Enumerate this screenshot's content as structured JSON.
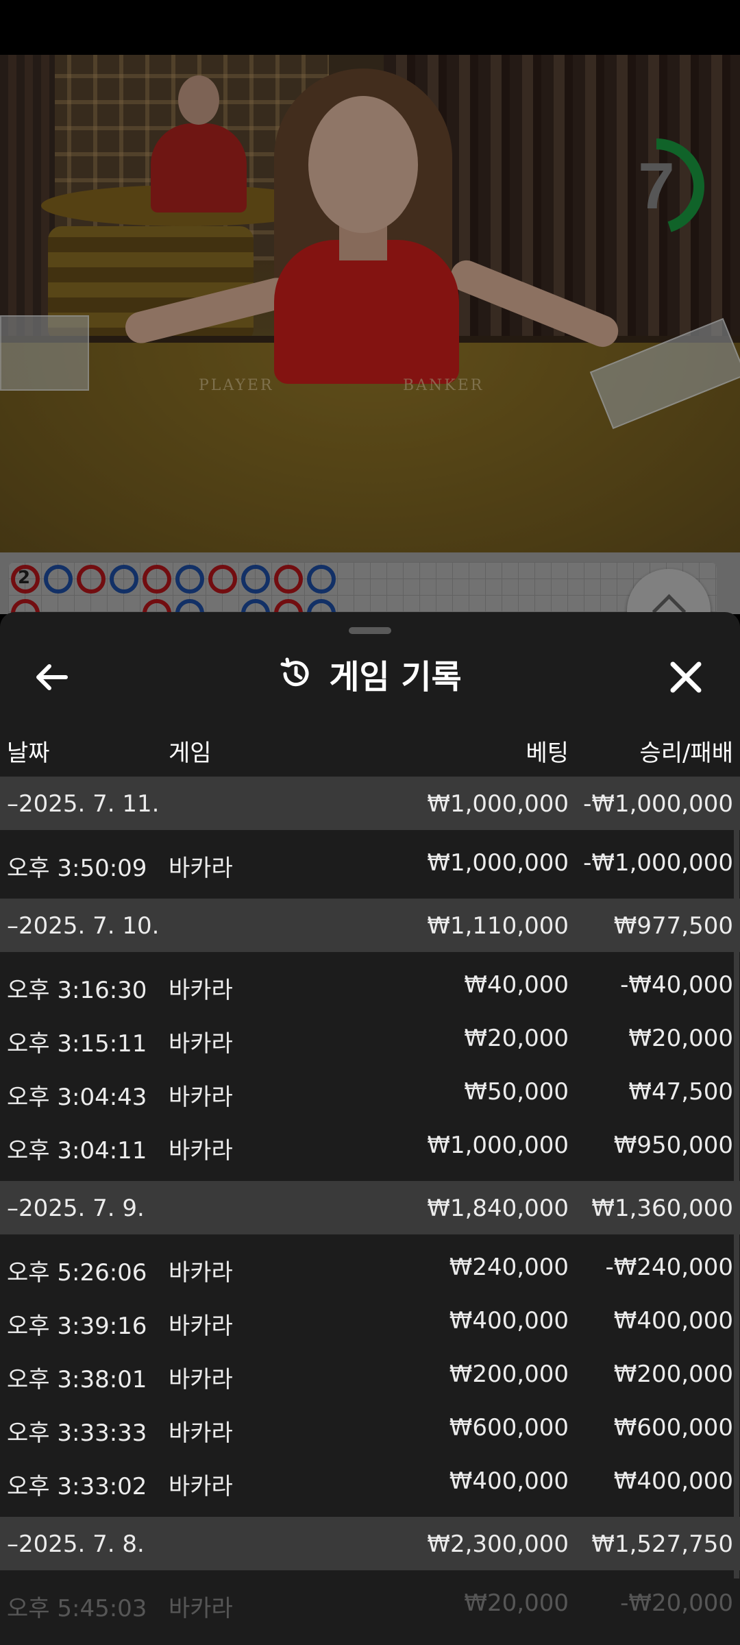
{
  "video": {
    "countdown": "7",
    "countdown_fraction": 0.45,
    "table_labels": {
      "player": "PLAYER",
      "banker": "BANKER"
    }
  },
  "roadmap": {
    "count": "2",
    "row1": [
      "red",
      "blue",
      "red",
      "blue",
      "red",
      "blue",
      "red",
      "blue",
      "red",
      "blue"
    ],
    "row2": [
      "red",
      "",
      "",
      "",
      "red",
      "blue",
      "",
      "blue",
      "red",
      "blue"
    ]
  },
  "sheet": {
    "title": "게임 기록",
    "icons": {
      "back": "arrow-left-icon",
      "history": "history-icon",
      "close": "close-icon"
    },
    "columns": {
      "date": "날짜",
      "game": "게임",
      "bet": "베팅",
      "win_loss": "승리/패배"
    },
    "days": [
      {
        "date": "–2025. 7. 11.",
        "bet": "₩1,000,000",
        "result": "-₩1,000,000",
        "rows": [
          {
            "time": "오후 3:50:09",
            "game": "바카라",
            "bet": "₩1,000,000",
            "result": "-₩1,000,000"
          }
        ]
      },
      {
        "date": "–2025. 7. 10.",
        "bet": "₩1,110,000",
        "result": "₩977,500",
        "rows": [
          {
            "time": "오후 3:16:30",
            "game": "바카라",
            "bet": "₩40,000",
            "result": "-₩40,000"
          },
          {
            "time": "오후 3:15:11",
            "game": "바카라",
            "bet": "₩20,000",
            "result": "₩20,000"
          },
          {
            "time": "오후 3:04:43",
            "game": "바카라",
            "bet": "₩50,000",
            "result": "₩47,500"
          },
          {
            "time": "오후 3:04:11",
            "game": "바카라",
            "bet": "₩1,000,000",
            "result": "₩950,000"
          }
        ]
      },
      {
        "date": "–2025. 7. 9.",
        "bet": "₩1,840,000",
        "result": "₩1,360,000",
        "rows": [
          {
            "time": "오후 5:26:06",
            "game": "바카라",
            "bet": "₩240,000",
            "result": "-₩240,000"
          },
          {
            "time": "오후 3:39:16",
            "game": "바카라",
            "bet": "₩400,000",
            "result": "₩400,000"
          },
          {
            "time": "오후 3:38:01",
            "game": "바카라",
            "bet": "₩200,000",
            "result": "₩200,000"
          },
          {
            "time": "오후 3:33:33",
            "game": "바카라",
            "bet": "₩600,000",
            "result": "₩600,000"
          },
          {
            "time": "오후 3:33:02",
            "game": "바카라",
            "bet": "₩400,000",
            "result": "₩400,000"
          }
        ]
      },
      {
        "date": "–2025. 7. 8.",
        "bet": "₩2,300,000",
        "result": "₩1,527,750",
        "rows": [
          {
            "time": "오후 5:45:03",
            "game": "바카라",
            "bet": "₩20,000",
            "result": "-₩20,000"
          }
        ]
      }
    ]
  }
}
